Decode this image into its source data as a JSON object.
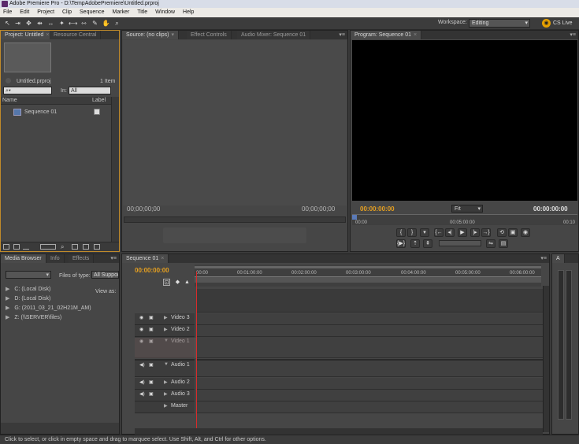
{
  "window": {
    "title": "Adobe Premiere Pro - D:\\TempAdobePremiere\\Untitled.prproj"
  },
  "menu": [
    "File",
    "Edit",
    "Project",
    "Clip",
    "Sequence",
    "Marker",
    "Title",
    "Window",
    "Help"
  ],
  "workspace": {
    "label": "Workspace:",
    "value": "Editing",
    "cslive": "CS Live"
  },
  "project_panel": {
    "tabs": [
      "Project: Untitled",
      "Resource Central"
    ],
    "project_name": "Untitled.prproj",
    "item_count": "1 Item",
    "in_label": "In:",
    "in_value": "All",
    "columns": {
      "name": "Name",
      "label": "Label"
    },
    "items": [
      {
        "name": "Sequence 01"
      }
    ]
  },
  "source_panel": {
    "tabs": [
      "Source: (no clips)",
      "Effect Controls",
      "Audio Mixer: Sequence 01"
    ],
    "timecode_left": "00;00;00;00",
    "timecode_right": "00;00;00;00"
  },
  "program_panel": {
    "tab": "Program: Sequence 01",
    "timecode_left": "00:00:00:00",
    "fit": "Fit",
    "timecode_right": "00:00:00:00",
    "ruler": [
      "00:00",
      "00:05:00:00",
      "00:10"
    ]
  },
  "media_panel": {
    "tabs": [
      "Media Browser",
      "Info",
      "Effects"
    ],
    "files_of_type_label": "Files of type:",
    "files_of_type_value": "All Support",
    "view_as": "View as:",
    "drives": [
      "C: (Local Disk)",
      "D: (Local Disk)",
      "G: (2011_03_21_02H21M_AM)",
      "Z: (\\\\SERVER\\files)"
    ]
  },
  "timeline": {
    "tab": "Sequence 01",
    "timecode": "00:00:00:00",
    "ruler": [
      "00:00",
      "00:01:00:00",
      "00:02:00:00",
      "00:03:00:00",
      "00:04:00:00",
      "00:05:00:00",
      "00:06:00:00"
    ],
    "tracks": [
      "Video 3",
      "Video 2",
      "Video 1",
      "Audio 1",
      "Audio 2",
      "Audio 3",
      "Master"
    ]
  },
  "meters": {
    "tab": "A"
  },
  "status": "Click to select, or click in empty space and drag to marquee select. Use Shift, Alt, and Ctrl for other options.",
  "colors": {
    "accent_timecode": "#e6a020",
    "playhead": "#d82a2a",
    "panel_active_border": "#c08a2a"
  }
}
